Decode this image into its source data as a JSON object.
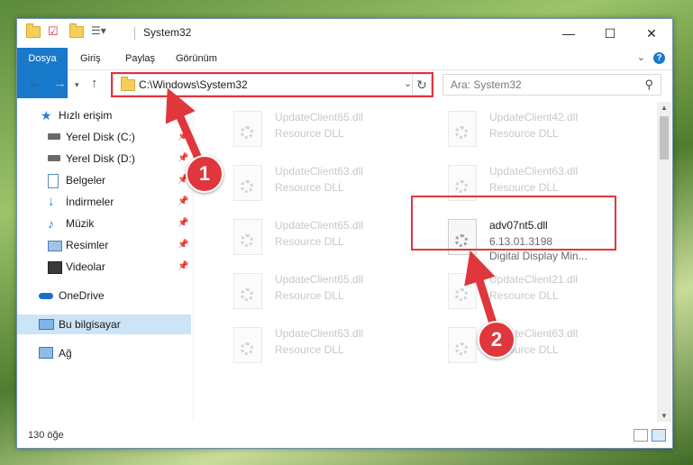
{
  "window": {
    "title": "System32",
    "controls": {
      "minimize": "—",
      "maximize": "☐",
      "close": "✕"
    }
  },
  "ribbon": {
    "tabs": [
      "Dosya",
      "Giriş",
      "Paylaş",
      "Görünüm"
    ],
    "help": "?"
  },
  "address": {
    "path": "C:\\Windows\\System32",
    "search_placeholder": "Ara: System32"
  },
  "sidebar": {
    "items": [
      {
        "label": "Hızlı erişim",
        "icon": "star-icon"
      },
      {
        "label": "Yerel Disk (C:)",
        "icon": "drive-icon",
        "pinned": true
      },
      {
        "label": "Yerel Disk (D:)",
        "icon": "drive-icon",
        "pinned": true
      },
      {
        "label": "Belgeler",
        "icon": "document-icon",
        "pinned": true
      },
      {
        "label": "İndirmeler",
        "icon": "download-icon",
        "pinned": true
      },
      {
        "label": "Müzik",
        "icon": "music-icon",
        "pinned": true
      },
      {
        "label": "Resimler",
        "icon": "picture-icon",
        "pinned": true
      },
      {
        "label": "Videolar",
        "icon": "video-icon",
        "pinned": true
      },
      {
        "label": "OneDrive",
        "icon": "cloud-icon"
      },
      {
        "label": "Bu bilgisayar",
        "icon": "computer-icon",
        "selected": true
      },
      {
        "label": "Ağ",
        "icon": "network-icon"
      }
    ]
  },
  "files": [
    {
      "name": "UpdateClient65.dll",
      "type": "Resource DLL"
    },
    {
      "name": "UpdateClient42.dll",
      "type": "Resource DLL"
    },
    {
      "name": "UpdateClient63.dll",
      "type": "Resource DLL"
    },
    {
      "name": "UpdateClient63.dll",
      "type": "Resource DLL"
    },
    {
      "name": "UpdateClient65.dll",
      "type": "Resource DLL"
    },
    {
      "name": "adv07nt5.dll",
      "type": "6.13.01.3198",
      "desc": "Digital Display Min..."
    },
    {
      "name": "UpdateClient65.dll",
      "type": "Resource DLL"
    },
    {
      "name": "UpdateClient21.dll",
      "type": "Resource DLL"
    },
    {
      "name": "UpdateClient63.dll",
      "type": "Resource DLL"
    },
    {
      "name": "UpdateClient63.dll",
      "type": "Resource DLL"
    }
  ],
  "status": {
    "count": "130 öğe"
  },
  "annotations": {
    "step1": "1",
    "step2": "2",
    "color": "#e0373c"
  }
}
